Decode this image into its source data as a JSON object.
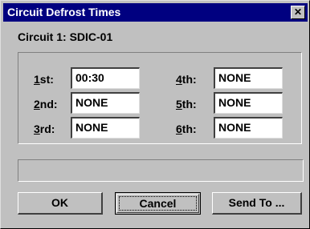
{
  "window": {
    "title": "Circuit Defrost Times",
    "close_glyph": "✕"
  },
  "circuit": {
    "label": "Circuit 1: SDIC-01"
  },
  "fields": [
    {
      "label_mnemonic": "1",
      "label_rest": "st:",
      "value": "00:30"
    },
    {
      "label_mnemonic": "2",
      "label_rest": "nd:",
      "value": "NONE"
    },
    {
      "label_mnemonic": "3",
      "label_rest": "rd:",
      "value": "NONE"
    },
    {
      "label_mnemonic": "4",
      "label_rest": "th:",
      "value": "NONE"
    },
    {
      "label_mnemonic": "5",
      "label_rest": "th:",
      "value": "NONE"
    },
    {
      "label_mnemonic": "6",
      "label_rest": "th:",
      "value": "NONE"
    }
  ],
  "status": {
    "text": ""
  },
  "buttons": {
    "ok": "OK",
    "cancel": "Cancel",
    "send_to": "Send To ..."
  },
  "colors": {
    "titlebar": "#000080",
    "face": "#c0c0c0"
  }
}
